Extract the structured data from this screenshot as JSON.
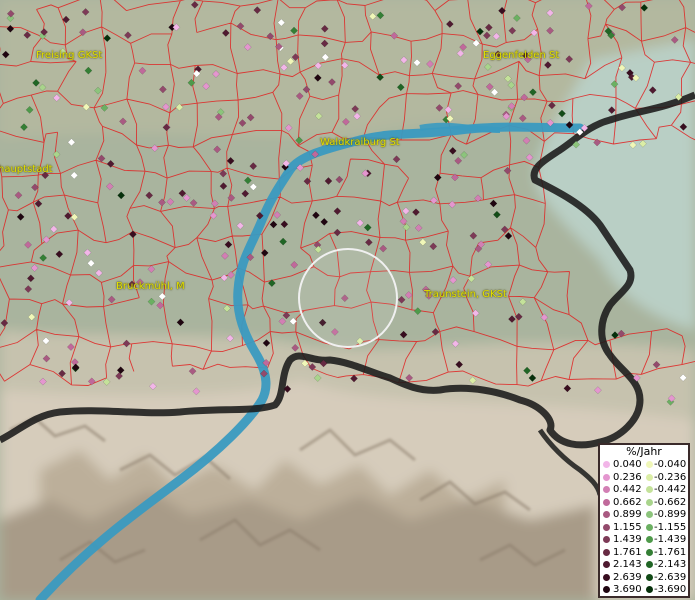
{
  "map": {
    "places": [
      {
        "id": "freising",
        "label": "Freising GKSt"
      },
      {
        "id": "eggenfelden",
        "label": "Eggenfelden St"
      },
      {
        "id": "waldkraiburg",
        "label": "Waldkraiburg St"
      },
      {
        "id": "hauptstadt",
        "label": "hauptstadt"
      },
      {
        "id": "bruckmuehl",
        "label": "Bruckmühl, M"
      },
      {
        "id": "traunstein",
        "label": "Traunstein, GKSt"
      }
    ],
    "colors": {
      "municipal_borders": "#e02020",
      "state_border": "#1a1a1a",
      "river": "#3a9ac0",
      "lake": "#b9cfc5",
      "lowland": "#a9b49e",
      "mountains": "#d9cdbb",
      "selection_circle": "#f0f0f0"
    }
  },
  "legend": {
    "title": "%/Jahr",
    "positive": [
      {
        "value": "0.040",
        "color": "#f2b6e8"
      },
      {
        "value": "0.236",
        "color": "#e496cf"
      },
      {
        "value": "0.442",
        "color": "#d27fb4"
      },
      {
        "value": "0.662",
        "color": "#c0699b"
      },
      {
        "value": "0.899",
        "color": "#a95a82"
      },
      {
        "value": "1.155",
        "color": "#934a6c"
      },
      {
        "value": "1.439",
        "color": "#7d3a57"
      },
      {
        "value": "1.761",
        "color": "#672a43"
      },
      {
        "value": "2.143",
        "color": "#4f1a30"
      },
      {
        "value": "2.639",
        "color": "#380d1f"
      },
      {
        "value": "3.690",
        "color": "#1f0510"
      }
    ],
    "negative": [
      {
        "value": "-0.040",
        "color": "#f0f7b8"
      },
      {
        "value": "-0.236",
        "color": "#dbeea6"
      },
      {
        "value": "-0.442",
        "color": "#c4e29a"
      },
      {
        "value": "-0.662",
        "color": "#a9d48c"
      },
      {
        "value": "-0.899",
        "color": "#8cc47c"
      },
      {
        "value": "-1.155",
        "color": "#6bb062"
      },
      {
        "value": "-1.439",
        "color": "#4e9a4a"
      },
      {
        "value": "-1.761",
        "color": "#347f35"
      },
      {
        "value": "-2.143",
        "color": "#206525"
      },
      {
        "value": "-2.639",
        "color": "#124b17"
      },
      {
        "value": "-3.690",
        "color": "#06300b"
      }
    ]
  }
}
